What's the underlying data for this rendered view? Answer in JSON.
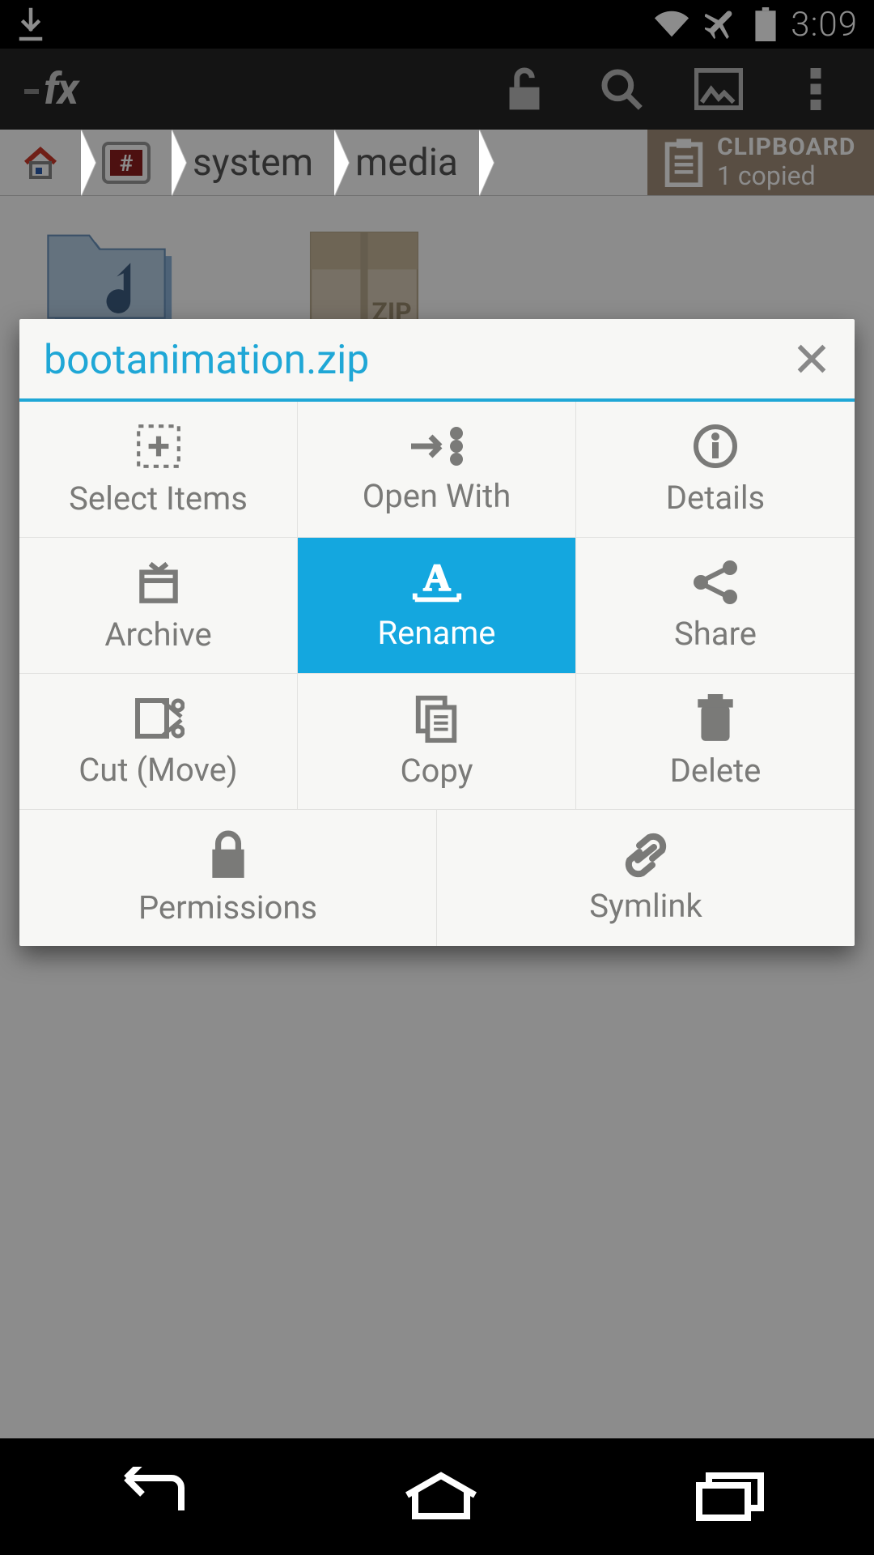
{
  "status": {
    "time": "3:09"
  },
  "breadcrumb": {
    "system": "system",
    "media": "media"
  },
  "clipboard": {
    "title": "CLIPBOARD",
    "subtitle": "1 copied"
  },
  "modal": {
    "title": "bootanimation.zip",
    "actions": {
      "select_items": "Select Items",
      "open_with": "Open With",
      "details": "Details",
      "archive": "Archive",
      "rename": "Rename",
      "share": "Share",
      "cut": "Cut (Move)",
      "copy": "Copy",
      "delete": "Delete",
      "permissions": "Permissions",
      "symlink": "Symlink"
    }
  }
}
